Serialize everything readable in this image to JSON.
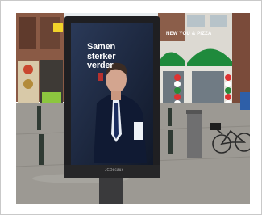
{
  "image": {
    "description_label": "Street photograph: digital advertising kiosk on a town square showing a man in a dark suit",
    "screen_text": [
      "Samen",
      "sterker",
      "verder"
    ],
    "kiosk_brand": "JCDecaux",
    "shop_sign": "NEW YOU & PIZZA",
    "colors": {
      "sky": "#e9eef2",
      "pavement": "#9a9790",
      "shop_green": "#1f8a3c",
      "kiosk_body": "#1f1f22",
      "screen_bg": "#1d2b45",
      "brick": "#7a4b3a"
    }
  }
}
